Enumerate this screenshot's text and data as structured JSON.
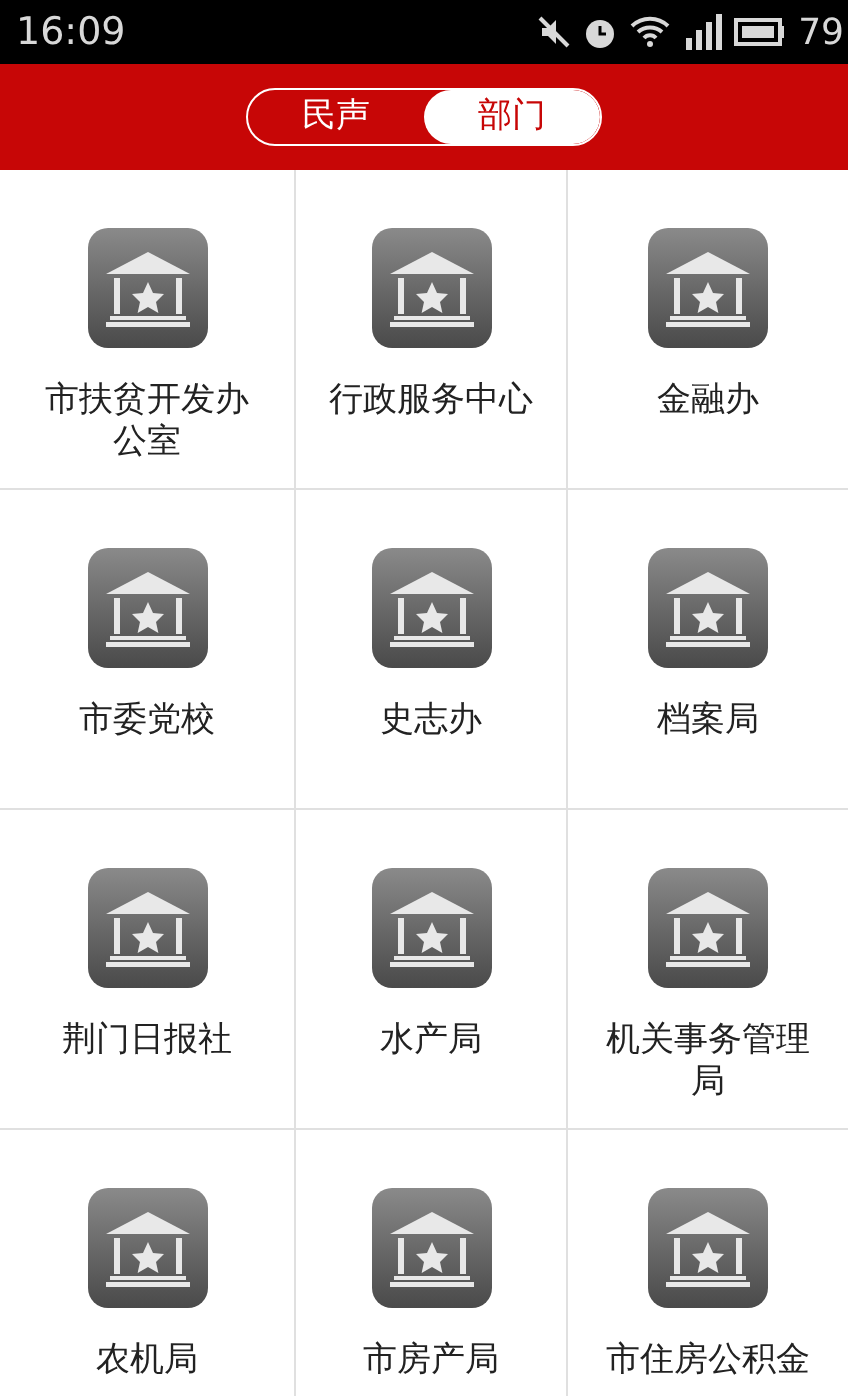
{
  "status_bar": {
    "time": "16:09",
    "battery": "79"
  },
  "tabs": [
    {
      "label": "民声",
      "selected": false
    },
    {
      "label": "部门",
      "selected": true
    }
  ],
  "departments": [
    {
      "label": "市扶贫开发办公室"
    },
    {
      "label": "行政服务中心"
    },
    {
      "label": "金融办"
    },
    {
      "label": "市委党校"
    },
    {
      "label": "史志办"
    },
    {
      "label": "档案局"
    },
    {
      "label": "荆门日报社"
    },
    {
      "label": "水产局"
    },
    {
      "label": "机关事务管理局"
    },
    {
      "label": "农机局"
    },
    {
      "label": "市房产局"
    },
    {
      "label": "市住房公积金"
    }
  ]
}
